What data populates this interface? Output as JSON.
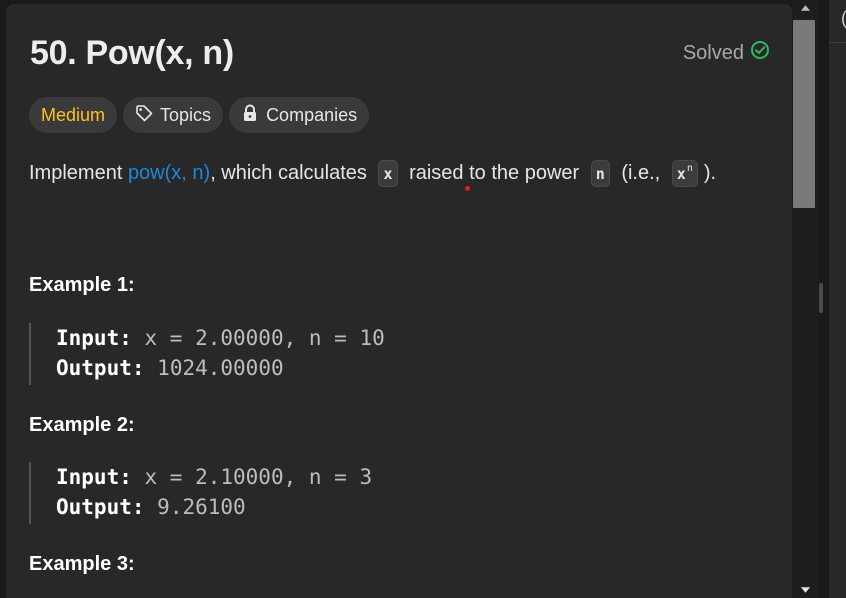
{
  "problem": {
    "title": "50. Pow(x, n)",
    "status": "Solved",
    "difficulty": "Medium",
    "topics_label": "Topics",
    "companies_label": "Companies"
  },
  "description": {
    "part1": "Implement ",
    "link": "pow(x, n)",
    "part2": ", which calculates ",
    "code_x": "x",
    "part3": " raised to the power ",
    "code_n": "n",
    "part4": " (i.e., ",
    "code_xn_base": "x",
    "code_xn_exp": "n",
    "part5": ")."
  },
  "examples": [
    {
      "title": "Example 1:",
      "input_label": "Input:",
      "input_value": "x = 2.00000, n = 10",
      "output_label": "Output:",
      "output_value": "1024.00000"
    },
    {
      "title": "Example 2:",
      "input_label": "Input:",
      "input_value": "x = 2.10000, n = 3",
      "output_label": "Output:",
      "output_value": "9.26100"
    },
    {
      "title": "Example 3:"
    }
  ],
  "right_panel": {
    "partial_char": "("
  },
  "colors": {
    "medium": "#ffc01e",
    "link": "#1e86e0",
    "solved_check": "#2cbb5d",
    "panel_bg": "#282828"
  },
  "icons": [
    "check-circle-icon",
    "tag-icon",
    "lock-icon",
    "scroll-up-arrow-icon",
    "scroll-down-arrow-icon"
  ]
}
